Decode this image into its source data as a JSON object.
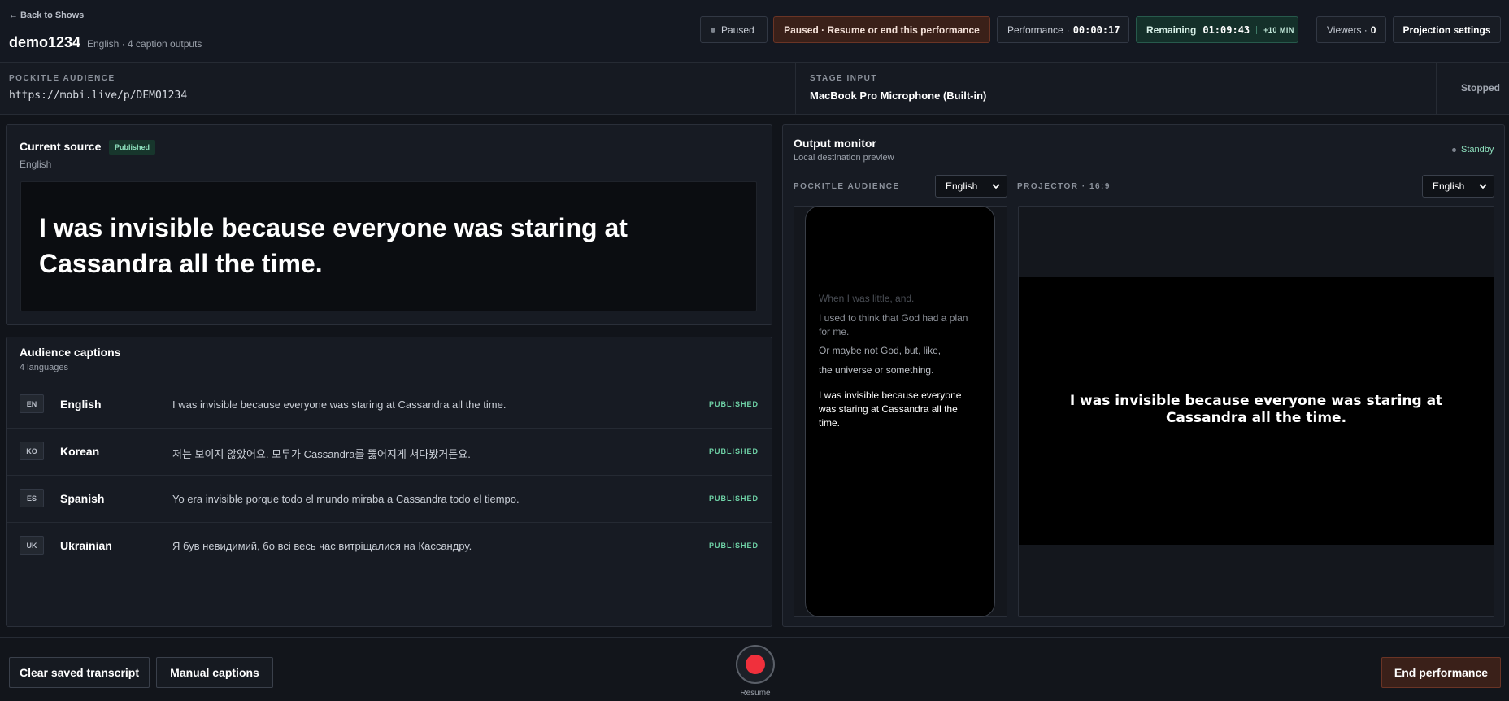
{
  "header": {
    "back_label": "← Back to Shows",
    "show_title": "demo1234",
    "show_subtitle": "English · 4 caption outputs",
    "status_paused": "Paused",
    "resume_prompt": "Paused · Resume or end this performance",
    "performance_label": "Performance",
    "performance_time": "00:00:17",
    "remaining_label": "Remaining",
    "remaining_time": "01:09:43",
    "add_time_label": "+10 MIN",
    "viewers_label": "Viewers ·",
    "viewers_count": "0",
    "projection_settings_label": "Projection settings"
  },
  "infobar": {
    "audience_label": "POCKITLE AUDIENCE",
    "audience_url": "https://mobi.live/p/DEMO1234",
    "stage_input_label": "STAGE INPUT",
    "stage_input_device": "MacBook Pro Microphone (Built-in)",
    "input_status": "Stopped"
  },
  "current_source": {
    "title": "Current source",
    "badge": "Published",
    "language": "English",
    "text": "I was invisible because everyone was staring at Cassandra all the time."
  },
  "audience_captions": {
    "title": "Audience captions",
    "subtitle": "4 languages",
    "rows": [
      {
        "code": "EN",
        "language": "English",
        "text": "I was invisible because everyone was staring at Cassandra all the time.",
        "status": "PUBLISHED"
      },
      {
        "code": "KO",
        "language": "Korean",
        "text": "저는 보이지 않았어요. 모두가 Cassandra를 뚫어지게 쳐다봤거든요.",
        "status": "PUBLISHED"
      },
      {
        "code": "ES",
        "language": "Spanish",
        "text": "Yo era invisible porque todo el mundo miraba a Cassandra todo el tiempo.",
        "status": "PUBLISHED"
      },
      {
        "code": "UK",
        "language": "Ukrainian",
        "text": "Я був невидимий, бо всі весь час витріщалися на Кассандру.",
        "status": "PUBLISHED"
      }
    ]
  },
  "output_monitor": {
    "title": "Output monitor",
    "subtitle": "Local destination preview",
    "status": "Standby",
    "audience_label": "POCKITLE AUDIENCE",
    "audience_language": "English",
    "projector_label": "PROJECTOR · 16:9",
    "projector_language": "English",
    "phone_lines": [
      "When I was little, and.",
      "I used to think that God had a plan for me.",
      "Or maybe not God, but, like,",
      "the universe or something.",
      "I was invisible because everyone was staring at Cassandra all the time."
    ],
    "projector_text": "I was invisible because everyone was staring at Cassandra all the time."
  },
  "footer": {
    "clear_label": "Clear saved transcript",
    "manual_label": "Manual captions",
    "record_label": "Resume",
    "end_label": "End performance"
  },
  "colors": {
    "background": "#11141a",
    "accent_green": "#6fd3a7",
    "record_red": "#f0303c",
    "warning_bg": "#3a2019"
  }
}
